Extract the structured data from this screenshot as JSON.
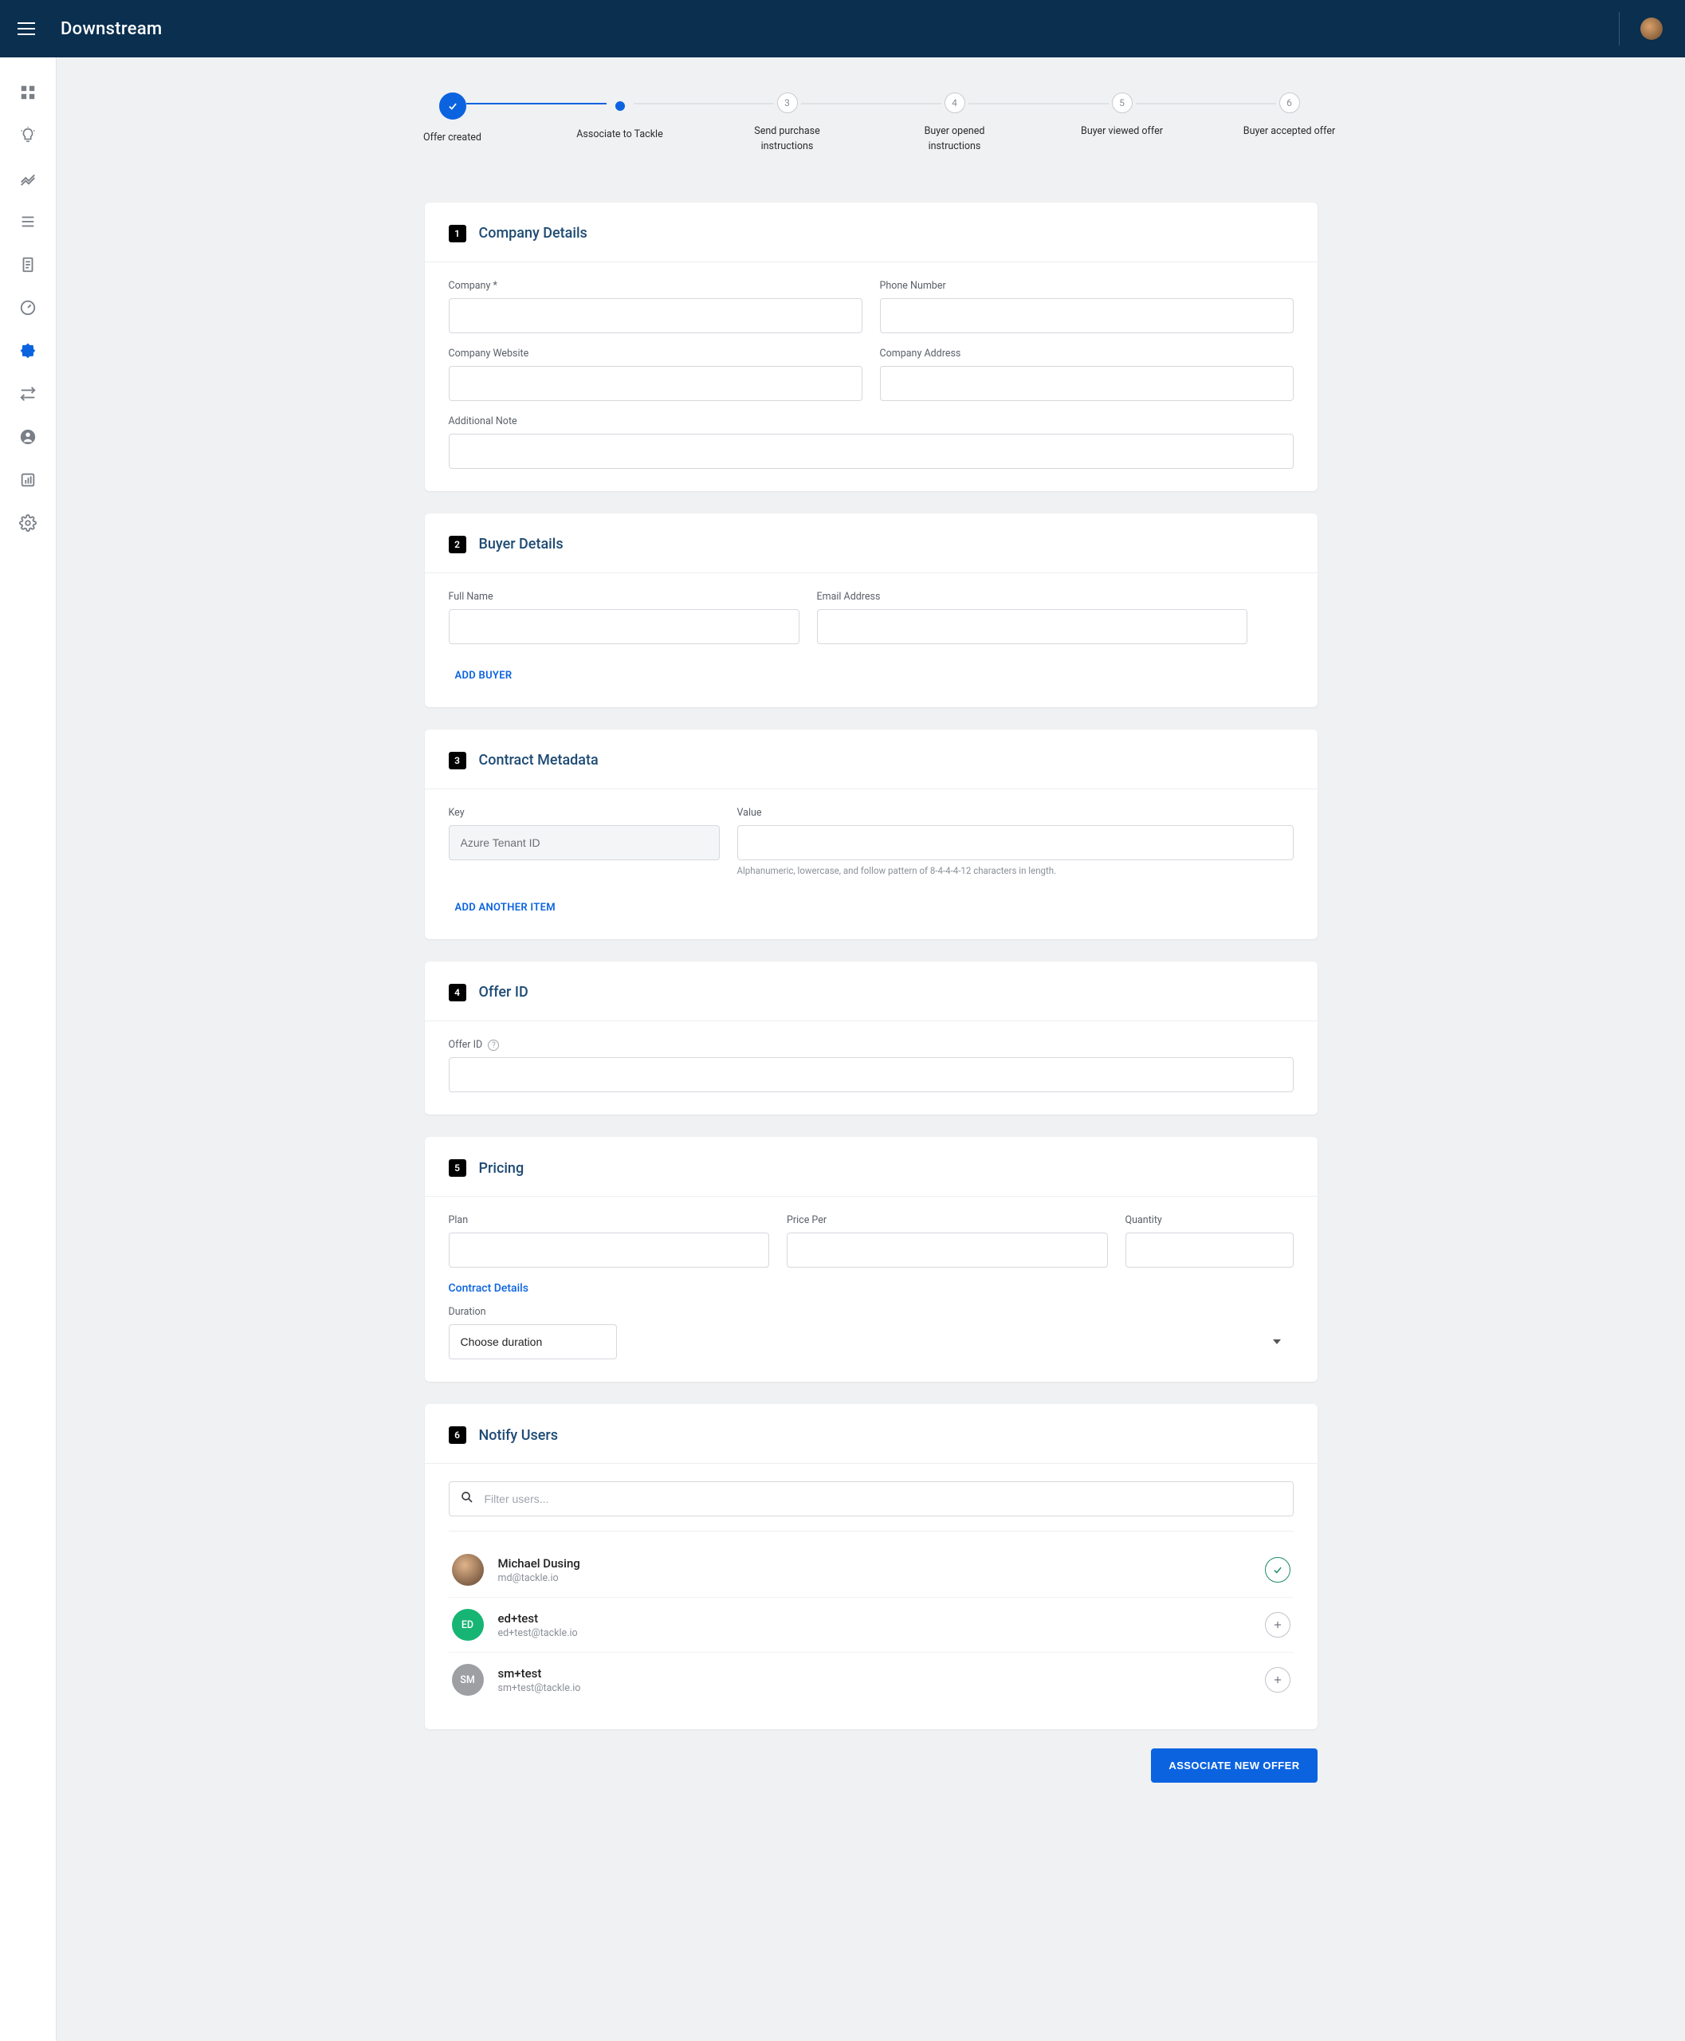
{
  "header": {
    "brand": "Downstream"
  },
  "steps": [
    {
      "label": "Offer created",
      "state": "done"
    },
    {
      "label": "Associate to Tackle",
      "state": "current"
    },
    {
      "label": "Send purchase instructions",
      "num": "3"
    },
    {
      "label": "Buyer opened instructions",
      "num": "4"
    },
    {
      "label": "Buyer viewed offer",
      "num": "5"
    },
    {
      "label": "Buyer accepted offer",
      "num": "6"
    }
  ],
  "sections": {
    "company": {
      "num": "1",
      "title": "Company Details",
      "labels": {
        "company": "Company *",
        "phone": "Phone Number",
        "website": "Company Website",
        "address": "Company Address",
        "note": "Additional Note"
      }
    },
    "buyer": {
      "num": "2",
      "title": "Buyer Details",
      "labels": {
        "full_name": "Full Name",
        "email": "Email Address"
      },
      "add_buyer": "Add Buyer"
    },
    "contract": {
      "num": "3",
      "title": "Contract Metadata",
      "labels": {
        "key": "Key",
        "value": "Value"
      },
      "key_value": "Azure Tenant ID",
      "hint": "Alphanumeric, lowercase, and follow pattern of 8-4-4-4-12 characters in length.",
      "add_item": "Add Another Item"
    },
    "offer": {
      "num": "4",
      "title": "Offer ID",
      "labels": {
        "offer_id": "Offer ID"
      }
    },
    "pricing": {
      "num": "5",
      "title": "Pricing",
      "labels": {
        "plan": "Plan",
        "price_per": "Price Per",
        "quantity": "Quantity",
        "contract_details": "Contract Details",
        "duration": "Duration"
      },
      "duration_placeholder": "Choose duration"
    },
    "notify": {
      "num": "6",
      "title": "Notify Users",
      "search_placeholder": "Filter users...",
      "users": [
        {
          "name": "Michael Dusing",
          "email": "md@tackle.io",
          "initials": "MD",
          "color": "#6b4f3b",
          "selected": true,
          "photo": true
        },
        {
          "name": "ed+test",
          "email": "ed+test@tackle.io",
          "initials": "ED",
          "color": "#16b573",
          "selected": false
        },
        {
          "name": "sm+test",
          "email": "sm+test@tackle.io",
          "initials": "SM",
          "color": "#9d9fa3",
          "selected": false
        }
      ]
    }
  },
  "actions": {
    "associate": "Associate New Offer"
  }
}
